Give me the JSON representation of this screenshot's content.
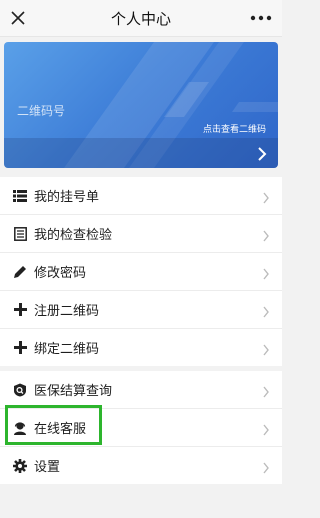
{
  "header": {
    "title": "个人中心",
    "close_icon": "close-icon",
    "more_icon": "more-icon"
  },
  "card": {
    "label": "二维码号",
    "link_text": "点击查看二维码",
    "chevron_icon": "chevron-right-icon"
  },
  "menu_group_1": [
    {
      "label": "我的挂号单",
      "icon": "list-icon"
    },
    {
      "label": "我的检查检验",
      "icon": "document-icon"
    },
    {
      "label": "修改密码",
      "icon": "pencil-icon"
    },
    {
      "label": "注册二维码",
      "icon": "plus-icon"
    },
    {
      "label": "绑定二维码",
      "icon": "plus-icon"
    }
  ],
  "menu_group_2": [
    {
      "label": "医保结算查询",
      "icon": "insurance-search-icon"
    },
    {
      "label": "在线客服",
      "icon": "customer-service-icon"
    },
    {
      "label": "设置",
      "icon": "gear-icon"
    }
  ],
  "colors": {
    "card_gradient_start": "#5aa0e8",
    "card_gradient_end": "#2f66c9",
    "highlight": "#2db52d"
  }
}
